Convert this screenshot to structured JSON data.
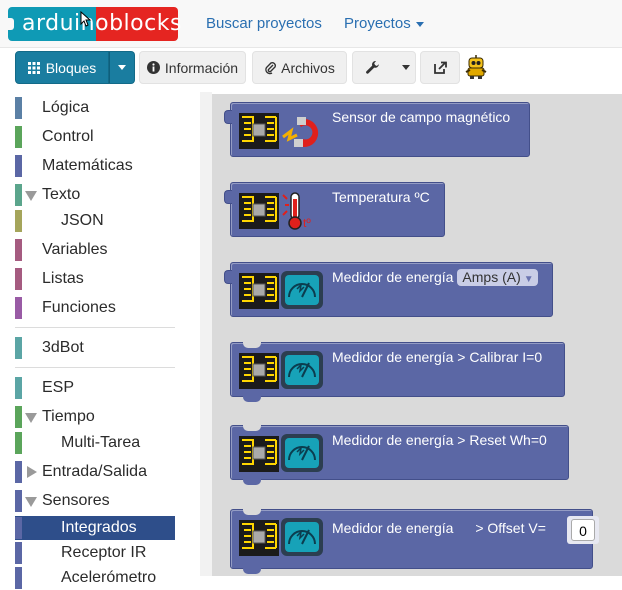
{
  "app": {
    "logo_text_left": "arduino",
    "logo_text_right": "blocks"
  },
  "nav": {
    "search_projects": "Buscar proyectos",
    "projects": "Proyectos"
  },
  "toolbar": {
    "blocks_label": "Bloques",
    "info_label": "Información",
    "files_label": "Archivos"
  },
  "sidebar": {
    "items": [
      {
        "label": "Lógica",
        "color": "#5b80a5"
      },
      {
        "label": "Control",
        "color": "#5ba55b"
      },
      {
        "label": "Matemáticas",
        "color": "#5b67a5"
      },
      {
        "label": "Texto",
        "color": "#5ba58c",
        "expanded": true
      },
      {
        "label": "JSON",
        "color": "#a5a55b"
      },
      {
        "label": "Variables",
        "color": "#a55b80"
      },
      {
        "label": "Listas",
        "color": "#a55b80"
      },
      {
        "label": "Funciones",
        "color": "#995ba5"
      },
      {
        "label": "3dBot",
        "color": "#5ba5a5"
      },
      {
        "label": "ESP",
        "color": "#5ba5a5"
      },
      {
        "label": "Tiempo",
        "color": "#5ba55b",
        "expanded": true
      },
      {
        "label": "Multi-Tarea",
        "color": "#5ba55b"
      },
      {
        "label": "Entrada/Salida",
        "color": "#5b67a5",
        "expanded": false
      },
      {
        "label": "Sensores",
        "color": "#5b67a5",
        "expanded": true
      },
      {
        "label": "Integrados",
        "color": "#5b67a5"
      },
      {
        "label": "Receptor IR",
        "color": "#5b67a5"
      },
      {
        "label": "Acelerómetro",
        "color": "#5b67a5"
      }
    ]
  },
  "blocks": [
    {
      "label": "Sensor de campo magnético",
      "icon": "magnet-icon"
    },
    {
      "label": "Temperatura ºC",
      "icon": "thermometer-icon"
    },
    {
      "label": "Medidor de energía",
      "icon": "energy-meter-icon",
      "dropdown": "Amps (A)"
    },
    {
      "label": "Medidor de energía > Calibrar I=0",
      "icon": "energy-meter-icon"
    },
    {
      "label": "Medidor de energía > Reset Wh=0",
      "icon": "energy-meter-icon"
    },
    {
      "label": "Medidor de energía",
      "suffix": "> Offset V=",
      "icon": "energy-meter-icon",
      "value": "0"
    }
  ],
  "colors": {
    "block": "#5b67a5",
    "workspace": "#dadada",
    "primary_button": "#1a7da0",
    "selected_category": "#2e4e8a"
  }
}
